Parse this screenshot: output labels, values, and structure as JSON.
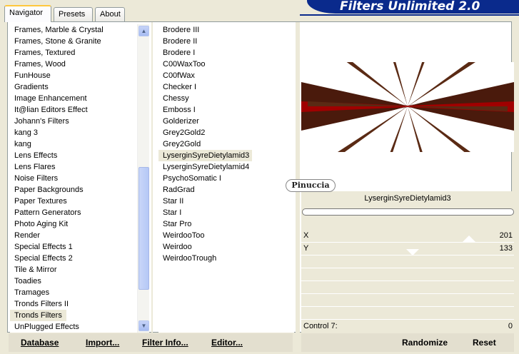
{
  "tabs": [
    "Navigator",
    "Presets",
    "About"
  ],
  "banner": "Filters Unlimited 2.0",
  "categories": [
    "Frames, Marble & Crystal",
    "Frames, Stone & Granite",
    "Frames, Textured",
    "Frames, Wood",
    "FunHouse",
    "Gradients",
    "Image Enhancement",
    "It@lian Editors Effect",
    "Johann's Filters",
    "kang 3",
    "kang",
    "Lens Effects",
    "Lens Flares",
    "Noise Filters",
    "Paper Backgrounds",
    "Paper Textures",
    "Pattern Generators",
    "Photo Aging Kit",
    "Render",
    "Special Effects 1",
    "Special Effects 2",
    "Tile & Mirror",
    "Toadies",
    "Tramages",
    "Tronds Filters II",
    "Tronds Filters",
    "UnPlugged Effects"
  ],
  "selected_category": "Tronds Filters",
  "filters": [
    "Brodere III",
    "Brodere II",
    "Brodere I",
    "C00WaxToo",
    "C00fWax",
    "Checker I",
    "Chessy",
    "Emboss I",
    "Golderizer",
    "Grey2Gold2",
    "Grey2Gold",
    "LyserginSyreDietylamid3",
    "LyserginSyreDietylamid4",
    "PsychoSomatic I",
    "RadGrad",
    "Star II",
    "Star I",
    "Star Pro",
    "WeirdooToo",
    "Weirdoo",
    "WeirdooTrough"
  ],
  "selected_filter": "LyserginSyreDietylamid3",
  "watermark": "Pinuccia",
  "params": {
    "filter_name": "LyserginSyreDietylamid3",
    "x_label": "X",
    "x_value": "201",
    "y_label": "Y",
    "y_value": "133",
    "c7_label": "Control 7:",
    "c7_value": "0"
  },
  "buttons": {
    "database": "Database",
    "import": "Import...",
    "filter_info": "Filter Info...",
    "editor": "Editor...",
    "randomize": "Randomize",
    "reset": "Reset"
  },
  "colors": {
    "banner": "#0a2a8c",
    "preview_dark": "#4a1a0c",
    "preview_red": "#a00000"
  }
}
